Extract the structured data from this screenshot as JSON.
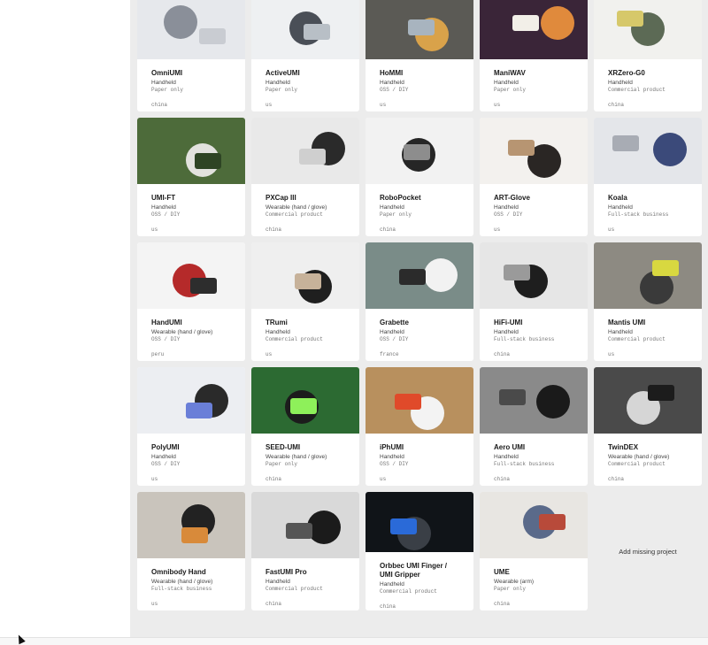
{
  "add_missing_label": "Add missing project",
  "projects": [
    {
      "name": "OmniUMI",
      "type": "Handheld",
      "stage": "Paper only",
      "country": "china",
      "bg": "#e6e8ec",
      "fg": "#8a8f99",
      "fg2": "#c9ccd2"
    },
    {
      "name": "ActiveUMI",
      "type": "Handheld",
      "stage": "Paper only",
      "country": "us",
      "bg": "#eef0f2",
      "fg": "#4a4f57",
      "fg2": "#b8bfc6"
    },
    {
      "name": "HoMMI",
      "type": "Handheld",
      "stage": "OSS / DIY",
      "country": "us",
      "bg": "#5b5a55",
      "fg": "#d9a24a",
      "fg2": "#a8b4bf"
    },
    {
      "name": "ManiWAV",
      "type": "Handheld",
      "stage": "Paper only",
      "country": "us",
      "bg": "#3a2538",
      "fg": "#e08a3c",
      "fg2": "#f2efe8"
    },
    {
      "name": "XRZero-G0",
      "type": "Handheld",
      "stage": "Commercial product",
      "country": "china",
      "bg": "#f1f1ee",
      "fg": "#5c6a55",
      "fg2": "#d6c86a"
    },
    {
      "name": "UMI-FT",
      "type": "Handheld",
      "stage": "OSS / DIY",
      "country": "us",
      "bg": "#4d6b3a",
      "fg": "#e2e2de",
      "fg2": "#2e4424"
    },
    {
      "name": "PXCap III",
      "type": "Wearable (hand / glove)",
      "stage": "Commercial product",
      "country": "china",
      "bg": "#e9e9e9",
      "fg": "#2a2a2a",
      "fg2": "#cfcfcf"
    },
    {
      "name": "RoboPocket",
      "type": "Handheld",
      "stage": "Paper only",
      "country": "china",
      "bg": "#f2f2f2",
      "fg": "#262626",
      "fg2": "#8d8d8d"
    },
    {
      "name": "ART-Glove",
      "type": "Handheld",
      "stage": "OSS / DIY",
      "country": "us",
      "bg": "#f3f1ee",
      "fg": "#2a2624",
      "fg2": "#b79572"
    },
    {
      "name": "Koala",
      "type": "Handheld",
      "stage": "Full-stack business",
      "country": "us",
      "bg": "#e4e6ea",
      "fg": "#3b4a7a",
      "fg2": "#a8acb4"
    },
    {
      "name": "HandUMI",
      "type": "Wearable (hand / glove)",
      "stage": "OSS / DIY",
      "country": "peru",
      "bg": "#f4f4f4",
      "fg": "#b52a2a",
      "fg2": "#2d2d2d"
    },
    {
      "name": "TRumi",
      "type": "Handheld",
      "stage": "Commercial product",
      "country": "us",
      "bg": "#efefef",
      "fg": "#1f1f1f",
      "fg2": "#c7b29a"
    },
    {
      "name": "Grabette",
      "type": "Handheld",
      "stage": "OSS / DIY",
      "country": "france",
      "bg": "#7a8c88",
      "fg": "#f2f2f2",
      "fg2": "#2b2b2b"
    },
    {
      "name": "HiFi-UMI",
      "type": "Handheld",
      "stage": "Full-stack business",
      "country": "china",
      "bg": "#e6e6e6",
      "fg": "#1e1e1e",
      "fg2": "#9a9a9a"
    },
    {
      "name": "Mantis UMI",
      "type": "Handheld",
      "stage": "Commercial product",
      "country": "us",
      "bg": "#8d8a82",
      "fg": "#3a3a3a",
      "fg2": "#d8d840"
    },
    {
      "name": "PolyUMI",
      "type": "Handheld",
      "stage": "OSS / DIY",
      "country": "us",
      "bg": "#eceef2",
      "fg": "#2a2a2a",
      "fg2": "#6a7fd8"
    },
    {
      "name": "SEED-UMI",
      "type": "Wearable (hand / glove)",
      "stage": "Paper only",
      "country": "china",
      "bg": "#2c6a32",
      "fg": "#1c1c1c",
      "fg2": "#8ef05a"
    },
    {
      "name": "iPhUMI",
      "type": "Handheld",
      "stage": "OSS / DIY",
      "country": "us",
      "bg": "#b8905e",
      "fg": "#f3f3f3",
      "fg2": "#e04a2a"
    },
    {
      "name": "Aero UMI",
      "type": "Handheld",
      "stage": "Full-stack business",
      "country": "china",
      "bg": "#8a8a8a",
      "fg": "#1a1a1a",
      "fg2": "#4a4a4a"
    },
    {
      "name": "TwinDEX",
      "type": "Wearable (hand / glove)",
      "stage": "Commercial product",
      "country": "china",
      "bg": "#4a4a4a",
      "fg": "#d6d6d6",
      "fg2": "#1c1c1c"
    },
    {
      "name": "Omnibody Hand",
      "type": "Wearable (hand / glove)",
      "stage": "Full-stack business",
      "country": "us",
      "bg": "#c9c4bc",
      "fg": "#222222",
      "fg2": "#d88a3a"
    },
    {
      "name": "FastUMI Pro",
      "type": "Handheld",
      "stage": "Commercial product",
      "country": "china",
      "bg": "#d9d9d9",
      "fg": "#1b1b1b",
      "fg2": "#555555"
    },
    {
      "name": "Orbbec UMI Finger / UMI Gripper",
      "type": "Handheld",
      "stage": "Commercial product",
      "country": "china",
      "bg": "#101418",
      "fg": "#3a3f46",
      "fg2": "#2a6ad8"
    },
    {
      "name": "UME",
      "type": "Wearable (arm)",
      "stage": "Paper only",
      "country": "china",
      "bg": "#e8e6e2",
      "fg": "#5a6a8a",
      "fg2": "#b84a3a"
    }
  ]
}
